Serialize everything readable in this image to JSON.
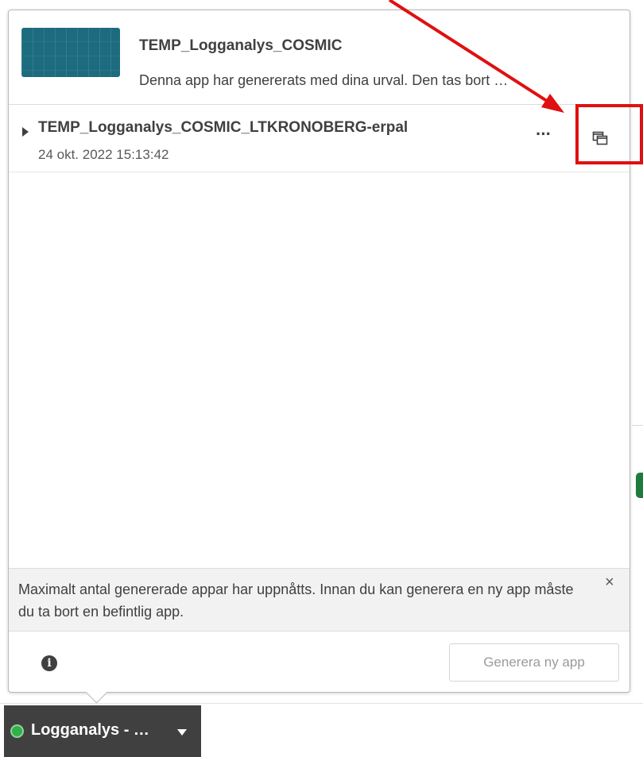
{
  "popover": {
    "app_title": "TEMP_Logganalys_COSMIC",
    "app_description": "Denna app har genererats med dina urval. Den tas bort …",
    "generated_app": {
      "name": "TEMP_Logganalys_COSMIC_LTKRONOBERG-erpal",
      "date": "24 okt. 2022 15:13:42",
      "more_label": "···"
    },
    "notice": {
      "text": "Maximalt antal genererade appar har uppnåtts. Innan du kan generera en ny app måste du ta bort en befintlig app.",
      "close_label": "×"
    },
    "footer": {
      "info_label": "i",
      "generate_button": "Generera ny app"
    }
  },
  "app_button": {
    "label": "Logganalys - …",
    "status_color": "#32b04a"
  },
  "icons": {
    "caret": "caret-right-icon",
    "more": "more-horizontal-icon",
    "open": "open-in-new-window-icon",
    "close": "close-icon",
    "info": "info-icon",
    "dropdown": "chevron-down-icon"
  },
  "annotation_color": "#e01010"
}
